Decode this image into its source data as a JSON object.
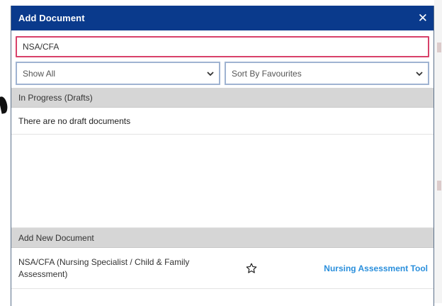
{
  "dialog": {
    "title": "Add Document",
    "close_label": "✕"
  },
  "search": {
    "value": "NSA/CFA"
  },
  "filters": {
    "show": {
      "selected": "Show All"
    },
    "sort": {
      "selected": "Sort By Favourites"
    }
  },
  "drafts": {
    "header": "In Progress (Drafts)",
    "empty_message": "There are no draft documents"
  },
  "add_new": {
    "header": "Add New Document",
    "items": [
      {
        "name": "NSA/CFA (Nursing Specialist / Child & Family Assessment)",
        "type": "Nursing Assessment Tool",
        "favourite": false
      }
    ]
  },
  "colors": {
    "titlebar": "#0a3a8c",
    "search_border": "#d8416a",
    "select_border": "#9fb3d1",
    "section_header": "#d6d6d6",
    "link": "#2a8fdc"
  },
  "icons": {
    "close": "close-icon",
    "dropdown": "chevron-down-icon",
    "favourite": "star-outline-icon"
  }
}
